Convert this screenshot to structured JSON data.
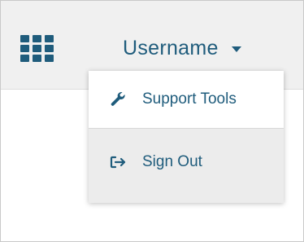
{
  "header": {
    "apps_icon": "grid-apps-icon",
    "username": "Username",
    "caret_icon": "caret-down-icon"
  },
  "menu": {
    "items": [
      {
        "label": "Support Tools",
        "icon": "wrench-icon"
      },
      {
        "label": "Sign Out",
        "icon": "sign-out-arrow-icon"
      }
    ]
  },
  "colors": {
    "accent": "#1f5c7c",
    "topbar_bg": "#f0f0f0",
    "menu_bg": "#ececec",
    "highlight_bg": "#ffffff"
  }
}
